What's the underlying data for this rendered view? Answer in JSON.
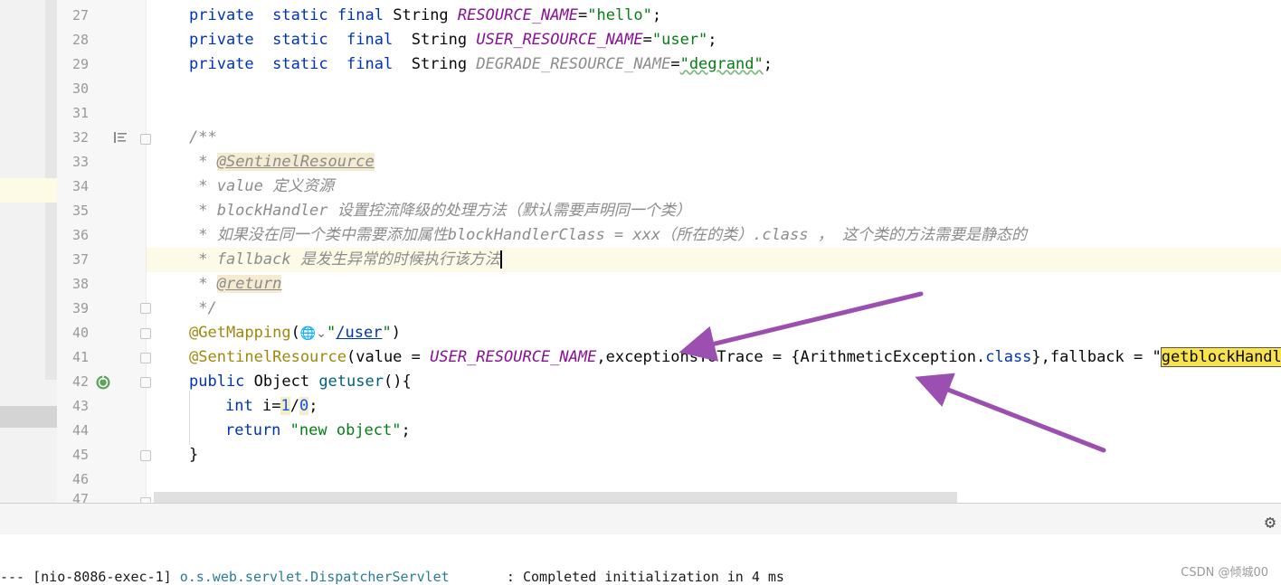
{
  "gutter": {
    "line_numbers": [
      "27",
      "28",
      "29",
      "30",
      "31",
      "32",
      "33",
      "34",
      "35",
      "36",
      "37",
      "38",
      "39",
      "40",
      "41",
      "42",
      "43",
      "44",
      "45",
      "46",
      "47"
    ]
  },
  "code": {
    "l27": {
      "kw1": "private",
      "kw2": "static",
      "kw3": "final",
      "type": "String",
      "name": "RESOURCE_NAME",
      "eq": "=",
      "val": "\"hello\"",
      "end": ";"
    },
    "l28": {
      "kw1": "private",
      "kw2": "static",
      "kw3": "final",
      "type": "String",
      "name": "USER_RESOURCE_NAME",
      "eq": "=",
      "val": "\"user\"",
      "end": ";"
    },
    "l29": {
      "kw1": "private",
      "kw2": "static",
      "kw3": "final",
      "type": "String",
      "name": "DEGRADE_RESOURCE_NAME",
      "eq": "=",
      "val": "\"degrand\"",
      "end": ";"
    },
    "l32": "/**",
    "l33_prefix": " * ",
    "l33_tag": "@SentinelResource",
    "l34": " * value 定义资源",
    "l35": " * blockHandler 设置控流降级的处理方法（默认需要声明同一个类）",
    "l36": " * 如果没在同一个类中需要添加属性blockHandlerClass = xxx（所在的类）.class ， 这个类的方法需要是静态的",
    "l37": " * fallback 是发生异常的时候执行该方法",
    "l38_prefix": " * ",
    "l38_tag": "@return",
    "l39": " */",
    "l40": {
      "ann": "@GetMapping",
      "open": "(",
      "globe": "🌐",
      "chev": "⌄",
      "q1": "\"",
      "url": "/user",
      "q2": "\"",
      "close": ")"
    },
    "l41": {
      "ann": "@SentinelResource",
      "p1": "(value = ",
      "const": "USER_RESOURCE_NAME",
      "p2": ",exceptionsToTrace = {ArithmeticException.",
      "kwclass": "class",
      "p3": "},fallback = \"",
      "hl": "getblockHandlerf"
    },
    "l42": {
      "kw": "public",
      "type": " Object ",
      "fn": "getuser",
      "rest": "(){"
    },
    "l43": {
      "kw": "int",
      "p1": " i=",
      "n1": "1",
      "slash": "/",
      "n2": "0",
      "end": ";"
    },
    "l44": {
      "kw": "return",
      "str": "\"new object\"",
      "end": ";"
    },
    "l45": "}",
    "l47": "/**"
  },
  "console": {
    "prefix": "--- [nio-8086-exec-1] ",
    "logger": "o.s.web.servlet.DispatcherServlet",
    "message": "       : Completed initialization in 4 ms"
  },
  "toolbar": {
    "gear_icon": "gear-icon"
  },
  "watermark": "CSDN @倾城00",
  "colors": {
    "arrow": "#9b4fb0",
    "keyword": "#0033b3",
    "string": "#067d17",
    "constant": "#871094",
    "annotation": "#9e880d",
    "highlight": "#f9e34c"
  }
}
